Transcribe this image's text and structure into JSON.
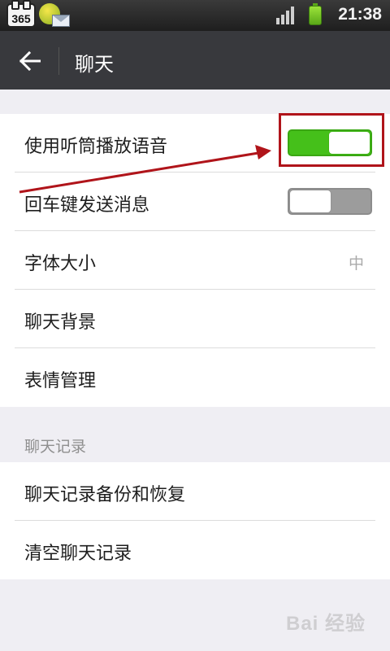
{
  "status_bar": {
    "app_icon_label": "365",
    "time": "21:38",
    "icons": [
      "app-365-icon",
      "wechat-icon",
      "mail-icon",
      "signal-icon",
      "battery-icon"
    ]
  },
  "action_bar": {
    "title": "聊天",
    "back_icon": "arrow-left-icon"
  },
  "settings": {
    "items": [
      {
        "label": "使用听筒播放语音",
        "type": "switch",
        "state": "on"
      },
      {
        "label": "回车键发送消息",
        "type": "switch",
        "state": "off"
      },
      {
        "label": "字体大小",
        "type": "value",
        "value": "中"
      },
      {
        "label": "聊天背景",
        "type": "link"
      },
      {
        "label": "表情管理",
        "type": "link"
      }
    ]
  },
  "chat_history": {
    "header": "聊天记录",
    "items": [
      {
        "label": "聊天记录备份和恢复"
      },
      {
        "label": "清空聊天记录"
      }
    ]
  },
  "watermark": "Bai 经验",
  "colors": {
    "switch_on": "#45c01a",
    "switch_off": "#9c9c9c",
    "action_bar": "#38393d",
    "background": "#efeef3",
    "annotation": "#b0141a"
  }
}
